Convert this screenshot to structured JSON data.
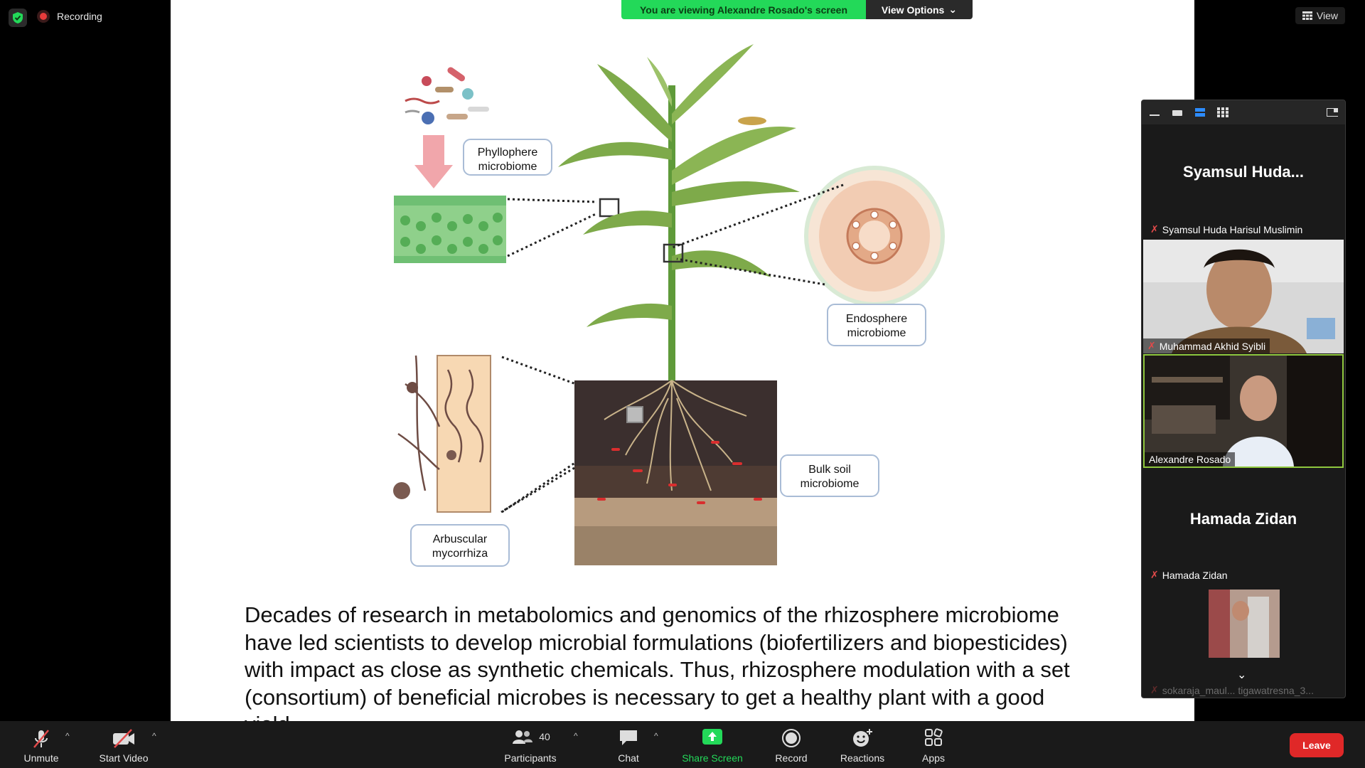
{
  "status": {
    "recording_label": "Recording"
  },
  "banner": {
    "viewing_text": "You are viewing Alexandre Rosado's screen",
    "view_options_label": "View Options"
  },
  "view_button": {
    "label": "View"
  },
  "slide": {
    "labels": {
      "phyllosphere": [
        "Phyllophere",
        "microbiome"
      ],
      "endosphere": [
        "Endosphere",
        "microbiome"
      ],
      "bulk_soil": [
        "Bulk soil",
        "microbiome"
      ],
      "arbuscular": [
        "Arbuscular",
        "mycorrhiza"
      ]
    },
    "paragraph_lines": [
      "Decades of research in metabolomics and genomics of the rhizosphere microbiome",
      "have led scientists to develop microbial formulations (biofertilizers and biopesticides)",
      "with impact as close as synthetic chemicals. Thus, rhizosphere modulation with a set",
      "(consortium) of beneficial microbes is necessary to get a healthy plant with a good",
      "yield."
    ]
  },
  "gallery": {
    "tiles": [
      {
        "big_name": "Syamsul Huda...",
        "name": "Syamsul Huda Harisul Muslimin",
        "muted": true
      },
      {
        "name": "Muhammad Akhid Syibli",
        "muted": true
      },
      {
        "name": "Alexandre Rosado",
        "muted": false
      },
      {
        "big_name": "Hamada Zidan",
        "name": "Hamada Zidan",
        "muted": true
      },
      {
        "name": "sokaraja_maul... tigawatresna_3...",
        "muted": true
      }
    ]
  },
  "toolbar": {
    "unmute": "Unmute",
    "start_video": "Start Video",
    "participants": "Participants",
    "participants_count": "40",
    "chat": "Chat",
    "share_screen": "Share Screen",
    "record": "Record",
    "reactions": "Reactions",
    "apps": "Apps",
    "leave": "Leave"
  },
  "colors": {
    "share_green": "#23d959",
    "leave_red": "#e02828",
    "active_speaker_border": "#8fc73e",
    "muted_red": "#e24a4a"
  }
}
